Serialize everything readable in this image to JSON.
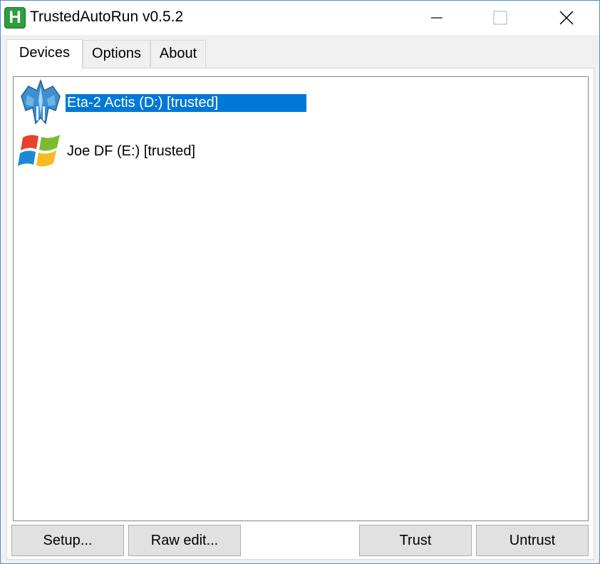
{
  "window": {
    "title": "TrustedAutoRun v0.5.2",
    "app_icon_letter": "H"
  },
  "tabs": [
    {
      "label": "Devices",
      "active": true
    },
    {
      "label": "Options",
      "active": false
    },
    {
      "label": "About",
      "active": false
    }
  ],
  "devices": [
    {
      "label": "Eta-2 Actis (D:) [trusted]",
      "icon": "starfighter-icon",
      "selected": true
    },
    {
      "label": "Joe DF (E:) [trusted]",
      "icon": "windows-logo-icon",
      "selected": false
    }
  ],
  "buttons": {
    "setup": "Setup...",
    "raw_edit": "Raw edit...",
    "trust": "Trust",
    "untrust": "Untrust"
  },
  "colors": {
    "selection": "#0078d7",
    "app_icon": "#2e9e3e"
  }
}
